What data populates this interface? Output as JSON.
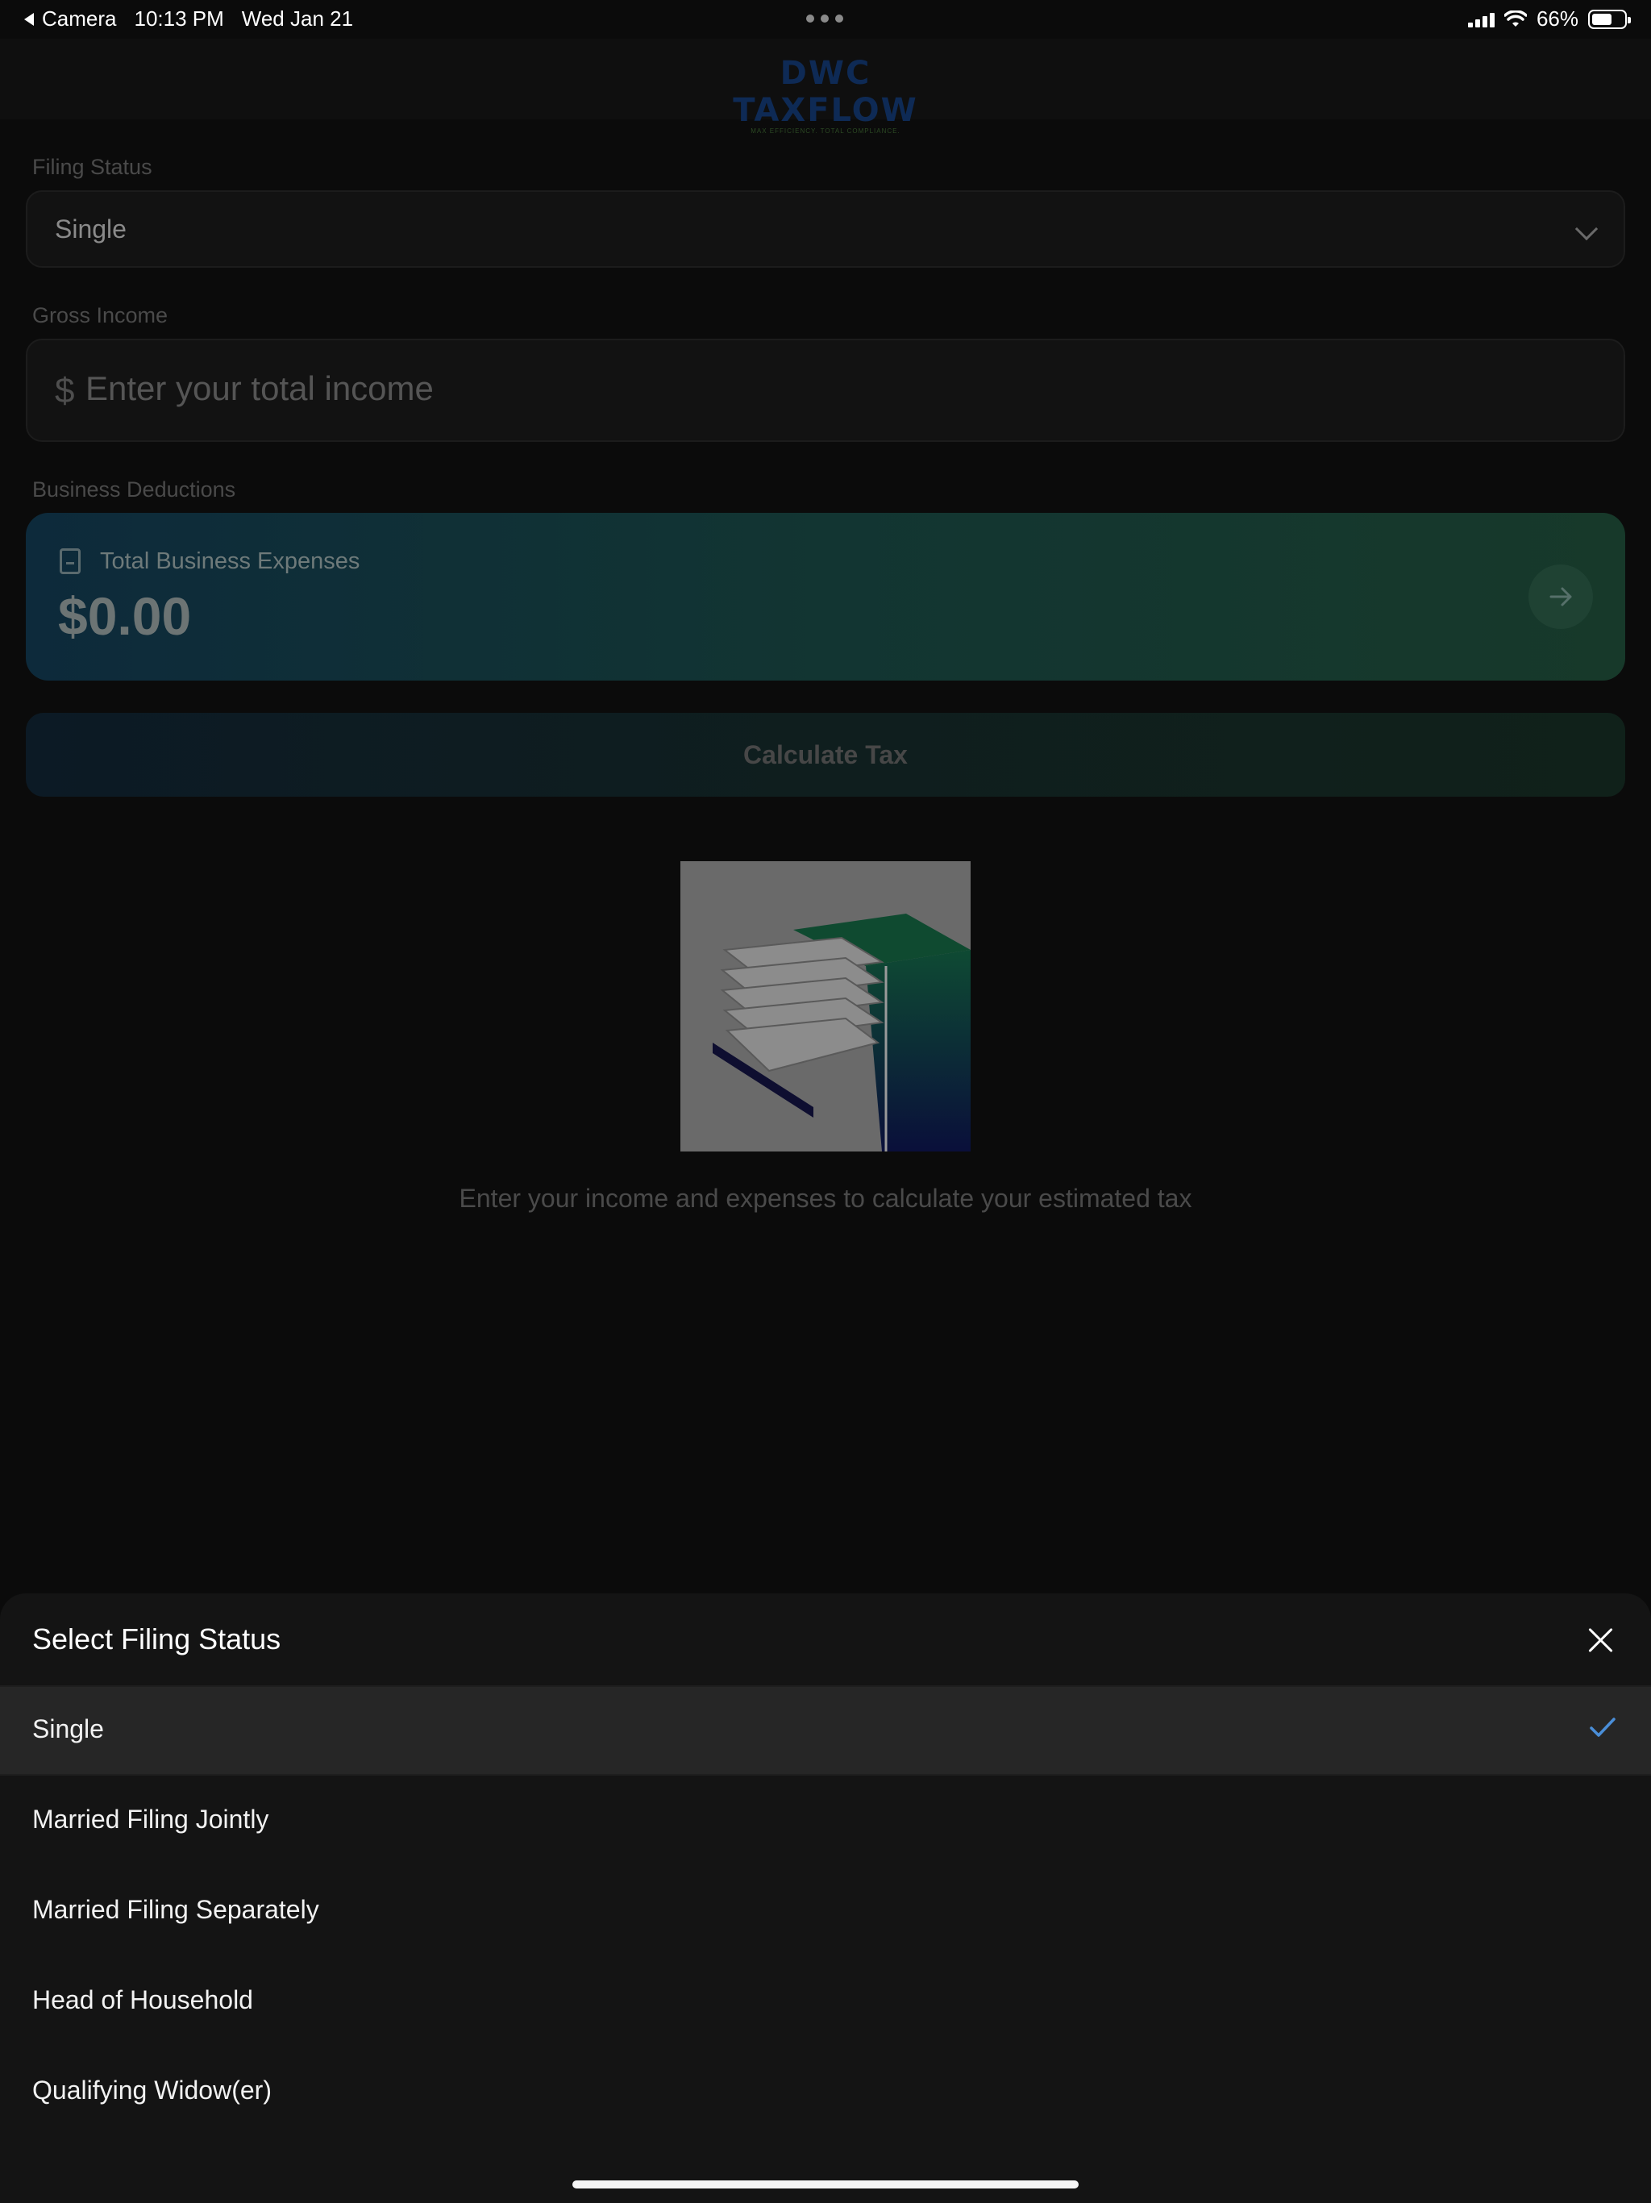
{
  "status_bar": {
    "back_app": "Camera",
    "time": "10:13 PM",
    "date": "Wed Jan 21",
    "battery": "66%"
  },
  "header": {
    "logo_text": "DWC TAXFLOW",
    "logo_tagline": "MAX EFFICIENCY. TOTAL COMPLIANCE."
  },
  "form": {
    "filing_status_label": "Filing Status",
    "filing_status_value": "Single",
    "gross_income_label": "Gross Income",
    "currency_symbol": "$",
    "gross_income_placeholder": "Enter your total income",
    "business_deductions_label": "Business Deductions",
    "expenses_title": "Total Business Expenses",
    "expenses_amount": "$0.00",
    "calculate_button": "Calculate Tax"
  },
  "empty_state": {
    "hint": "Enter your income and expenses to calculate your estimated tax"
  },
  "sheet": {
    "title": "Select Filing Status",
    "options": [
      {
        "label": "Single",
        "selected": true
      },
      {
        "label": "Married Filing Jointly",
        "selected": false
      },
      {
        "label": "Married Filing Separately",
        "selected": false
      },
      {
        "label": "Head of Household",
        "selected": false
      },
      {
        "label": "Qualifying Widow(er)",
        "selected": false
      }
    ]
  },
  "colors": {
    "accent_check": "#4a8ed8",
    "brand_blue": "#0e2a55",
    "brand_green": "#17392a"
  }
}
